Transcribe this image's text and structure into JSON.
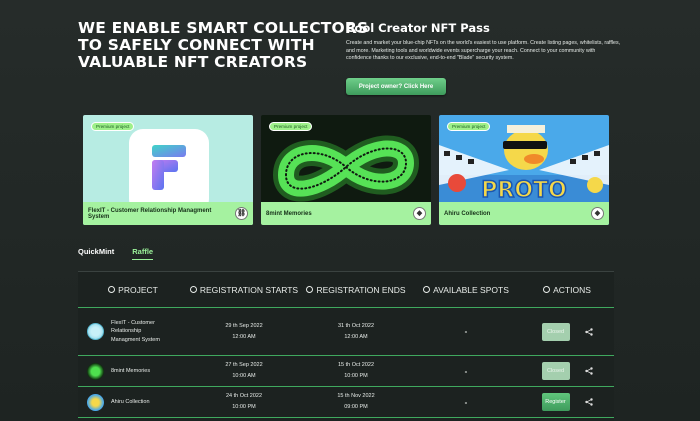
{
  "hero": {
    "title_lines": [
      "WE ENABLE SMART COLLECTORS",
      "TO SAFELY CONNECT WITH",
      "VALUABLE NFT CREATORS"
    ]
  },
  "pass": {
    "title": "Cool Creator NFT Pass",
    "description": "Create and market your blue-chip NFTs on the world's easiest to use platform. Create listing pages, whitelists, raffles, and more. Marketing tools and worldwide events supercharge your reach. Connect to your community with confidence thanks to our exclusive, end-to-end \"Blade\" security system.",
    "cta_label": "Project owner? Click Here"
  },
  "cards": [
    {
      "badge": "Premium project",
      "name": "FlexIT - Customer Relationship Managment System",
      "chain_icon": "link-icon"
    },
    {
      "badge": "Premium project",
      "name": "8mint Memories",
      "chain_icon": "ethereum-icon"
    },
    {
      "badge": "Premium project",
      "name": "Ahiru Collection",
      "chain_icon": "ethereum-icon"
    }
  ],
  "tabs": {
    "quickmint": "QuickMint",
    "raffle": "Raffle",
    "active": "raffle"
  },
  "table": {
    "headers": {
      "project": "PROJECT",
      "registration_starts": "REGISTRATION STARTS",
      "registration_ends": "REGISTRATION ENDS",
      "available_spots": "AVAILABLE SPOTS",
      "actions": "ACTIONS"
    },
    "rows": [
      {
        "name": "FlexIT - Customer Relationship Managment System",
        "start_date": "29 th Sep 2022",
        "start_time": "12:00 AM",
        "end_date": "31 th Oct 2022",
        "end_time": "12:00 AM",
        "spots": "-",
        "action": "Closed"
      },
      {
        "name": "8mint Memories",
        "start_date": "27 th Sep 2022",
        "start_time": "10:00 AM",
        "end_date": "15 th Oct 2022",
        "end_time": "10:00 PM",
        "spots": "-",
        "action": "Closed"
      },
      {
        "name": "Ahiru Collection",
        "start_date": "24 th Oct 2022",
        "start_time": "10:00 PM",
        "end_date": "15 th Nov 2022",
        "end_time": "09:00 PM",
        "spots": "-",
        "action": "Register"
      }
    ]
  },
  "colors": {
    "accent": "#9bf29a",
    "button_green": "#3e9b5c",
    "background": "#262c2a"
  }
}
